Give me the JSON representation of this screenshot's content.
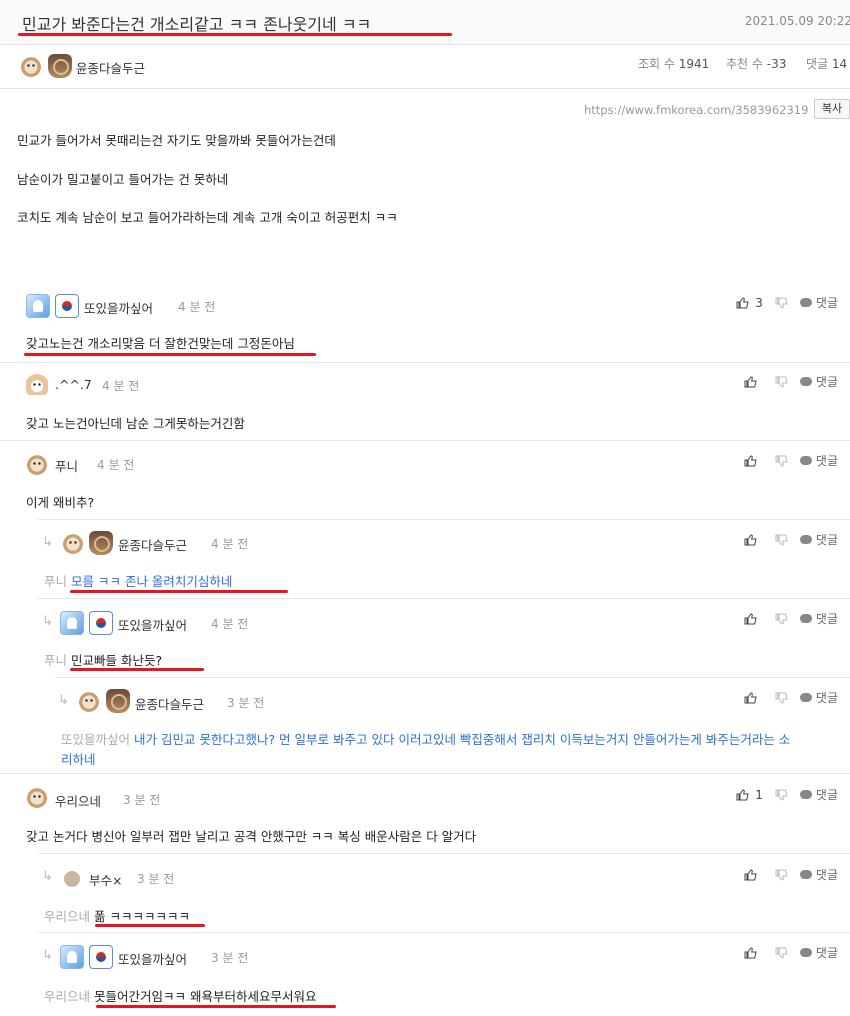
{
  "post": {
    "title": "민교가 봐준다는건 개소리같고 ㅋㅋ 존나웃기네 ㅋㅋ",
    "date": "2021.05.09 20:22",
    "author": "윤종다슬두근",
    "views_label": "조회 수",
    "views": "1941",
    "likes_label": "추천 수",
    "likes": "-33",
    "comments_label": "댓글",
    "comments": "14",
    "url": "https://www.fmkorea.com/3583962319",
    "copy_label": "복사",
    "paragraphs": [
      "민교가 들어가서 못때리는건 자기도 맞을까봐 못들어가는건데",
      "남순이가 밀고붙이고 들어가는 건 못하네",
      "코치도 계속 남순이 보고 들어가라하는데 계속 고개 숙이고 허공펀치 ㅋㅋ"
    ]
  },
  "reply_label": "댓글",
  "comments": [
    {
      "author": "또있을까싶어",
      "time": "4 분 전",
      "reply_to": "",
      "text": "갖고노는건 개소리맞음 더 잘한건맞는데 그정돈아님",
      "likes": "3"
    },
    {
      "author": ".^^.7",
      "time": "4 분 전",
      "reply_to": "",
      "text": "갖고 노는건아닌데 남순 그게못하는거긴함",
      "likes": ""
    },
    {
      "author": "푸니",
      "time": "4 분 전",
      "reply_to": "",
      "text": "이게 왜비추?",
      "likes": ""
    },
    {
      "author": "윤종다슬두근",
      "time": "4 분 전",
      "reply_to": "푸니",
      "text": "모름 ㅋㅋ 존나 올려치기심하네",
      "likes": ""
    },
    {
      "author": "또있을까싶어",
      "time": "4 분 전",
      "reply_to": "푸니",
      "text": "민교빠들 화난듯?",
      "likes": ""
    },
    {
      "author": "윤종다슬두근",
      "time": "3 분 전",
      "reply_to": "또있을까싶어",
      "text": "내가 김민교 못한다고했나? 먼 일부로 봐주고 있다 이러고있네 빡집중해서 잽리치 이득보는거지 안들어가는게 봐주는거라는 소",
      "text2": "리하네",
      "likes": ""
    },
    {
      "author": "우리으네",
      "time": "3 분 전",
      "reply_to": "",
      "text": "갖고 논거다 병신아 일부러 잽만 날리고 공격 안했구만 ㅋㅋ 복싱 배운사람은 다 알거다",
      "likes": "1"
    },
    {
      "author": "부수×",
      "time": "3 분 전",
      "reply_to": "우리으네",
      "text": "폶 ㅋㅋㅋㅋㅋㅋㅋ",
      "likes": ""
    },
    {
      "author": "또있을까싶어",
      "time": "3 분 전",
      "reply_to": "우리으네",
      "text": "못들어간거임ㅋㅋ 왜욕부터하세요무서워요",
      "likes": ""
    }
  ],
  "colors": {
    "underline": "#e8141e",
    "reply_blue": "#2a6fd6"
  }
}
